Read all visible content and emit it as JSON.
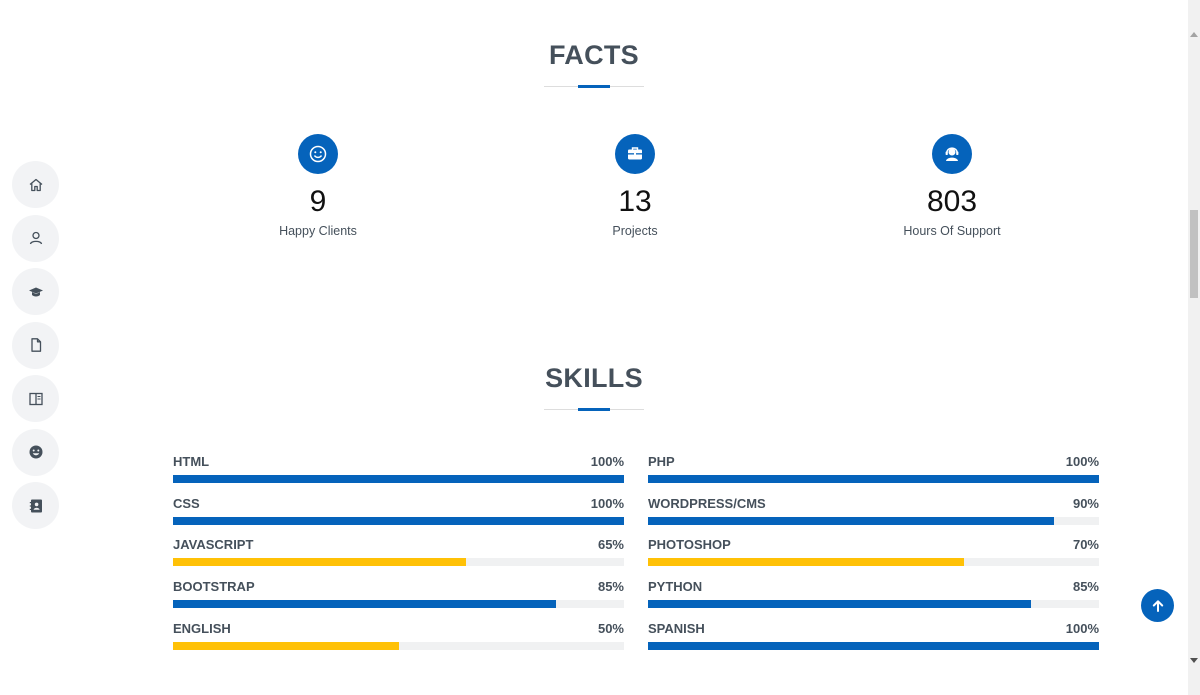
{
  "nav": {
    "items": [
      {
        "icon": "home-icon",
        "label": "Home"
      },
      {
        "icon": "person-icon",
        "label": "About"
      },
      {
        "icon": "graduation-cap-icon",
        "label": "Resume"
      },
      {
        "icon": "document-icon",
        "label": "Portfolio"
      },
      {
        "icon": "book-icon",
        "label": "Services"
      },
      {
        "icon": "smiley-icon",
        "label": "Testimonials"
      },
      {
        "icon": "contact-book-icon",
        "label": "Contact"
      }
    ]
  },
  "facts": {
    "title": "FACTS",
    "items": [
      {
        "icon": "smiley-icon",
        "number": "9",
        "label": "Happy Clients"
      },
      {
        "icon": "briefcase-icon",
        "number": "13",
        "label": "Projects"
      },
      {
        "icon": "headset-icon",
        "number": "803",
        "label": "Hours Of Support"
      }
    ]
  },
  "skills": {
    "title": "SKILLS",
    "colors": {
      "primary": "#0563bb",
      "accent": "#ffc107"
    },
    "left": [
      {
        "name": "HTML",
        "value": "100%",
        "percent": 100,
        "color": "#0563bb"
      },
      {
        "name": "CSS",
        "value": "100%",
        "percent": 100,
        "color": "#0563bb"
      },
      {
        "name": "JAVASCRIPT",
        "value": "65%",
        "percent": 65,
        "color": "#ffc107"
      },
      {
        "name": "BOOTSTRAP",
        "value": "85%",
        "percent": 85,
        "color": "#0563bb"
      },
      {
        "name": "ENGLISH",
        "value": "50%",
        "percent": 50,
        "color": "#ffc107"
      }
    ],
    "right": [
      {
        "name": "PHP",
        "value": "100%",
        "percent": 100,
        "color": "#0563bb"
      },
      {
        "name": "WORDPRESS/CMS",
        "value": "90%",
        "percent": 90,
        "color": "#0563bb"
      },
      {
        "name": "PHOTOSHOP",
        "value": "70%",
        "percent": 70,
        "color": "#ffc107"
      },
      {
        "name": "PYTHON",
        "value": "85%",
        "percent": 85,
        "color": "#0563bb"
      },
      {
        "name": "SPANISH",
        "value": "100%",
        "percent": 100,
        "color": "#0563bb"
      }
    ]
  },
  "back_to_top": {
    "icon": "arrow-up-icon"
  }
}
